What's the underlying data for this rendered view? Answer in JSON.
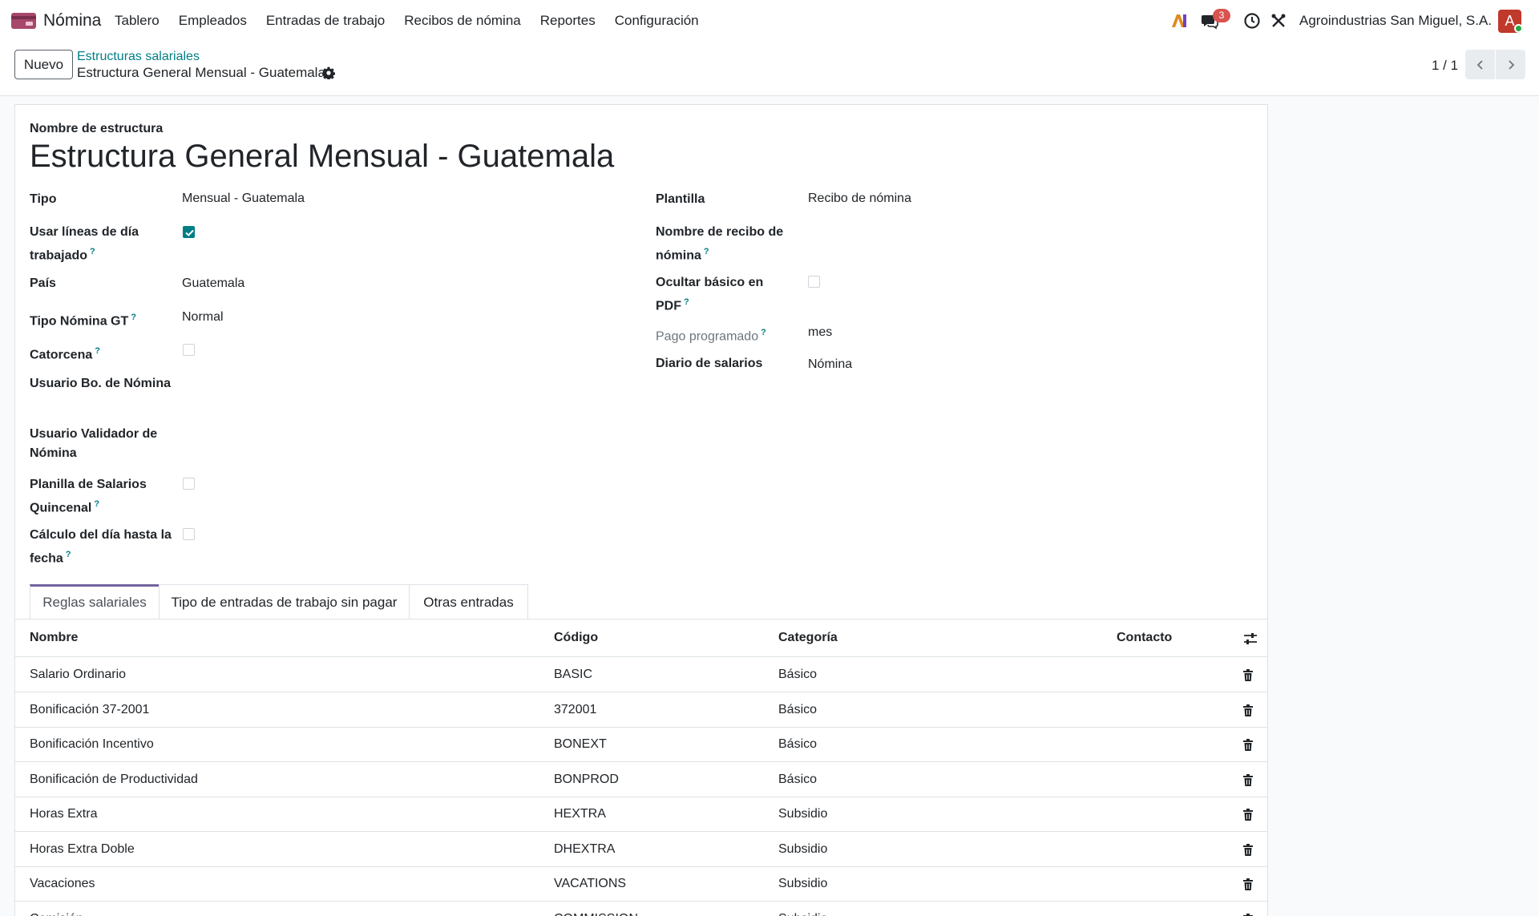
{
  "navbar": {
    "app_name": "Nómina",
    "menu": [
      "Tablero",
      "Empleados",
      "Entradas de trabajo",
      "Recibos de nómina",
      "Reportes",
      "Configuración"
    ],
    "chat_count": "3",
    "company": "Agroindustrias San Miguel, S.A.",
    "avatar_letter": "A"
  },
  "control": {
    "new_label": "Nuevo",
    "breadcrumb_parent": "Estructuras salariales",
    "breadcrumb_current": "Estructura General Mensual - Guatemala",
    "pager": "1 / 1"
  },
  "form": {
    "struct_label": "Nombre de estructura",
    "struct_name": "Estructura General Mensual - Guatemala",
    "left": {
      "tipo_label": "Tipo",
      "tipo_value": "Mensual - Guatemala",
      "usar_lineas_label": "Usar líneas de día trabajado",
      "pais_label": "País",
      "pais_value": "Guatemala",
      "tipo_nomina_label": "Tipo Nómina GT",
      "tipo_nomina_value": "Normal",
      "catorcena_label": "Catorcena",
      "usuario_bo_label": "Usuario Bo. de Nómina",
      "usuario_val_label": "Usuario Validador de Nómina",
      "planilla_label": "Planilla de Salarios Quincenal",
      "calculo_label": "Cálculo del día hasta la fecha"
    },
    "right": {
      "plantilla_label": "Plantilla",
      "plantilla_value": "Recibo de nómina",
      "nombre_recibo_label": "Nombre de recibo de nómina",
      "ocultar_label": "Ocultar básico en PDF",
      "pago_label": "Pago programado",
      "pago_value": "mes",
      "diario_label": "Diario de salarios",
      "diario_value": "Nómina"
    },
    "help_mark": "?"
  },
  "tabs": [
    "Reglas salariales",
    "Tipo de entradas de trabajo sin pagar",
    "Otras entradas"
  ],
  "table": {
    "headers": [
      "Nombre",
      "Código",
      "Categoría",
      "Contacto"
    ],
    "rows": [
      {
        "nombre": "Salario Ordinario",
        "codigo": "BASIC",
        "categoria": "Básico"
      },
      {
        "nombre": "Bonificación 37-2001",
        "codigo": "372001",
        "categoria": "Básico"
      },
      {
        "nombre": "Bonificación Incentivo",
        "codigo": "BONEXT",
        "categoria": "Básico"
      },
      {
        "nombre": "Bonificación de Productividad",
        "codigo": "BONPROD",
        "categoria": "Básico"
      },
      {
        "nombre": "Horas Extra",
        "codigo": "HEXTRA",
        "categoria": "Subsidio"
      },
      {
        "nombre": "Horas Extra Doble",
        "codigo": "DHEXTRA",
        "categoria": "Subsidio"
      },
      {
        "nombre": "Vacaciones",
        "codigo": "VACATIONS",
        "categoria": "Subsidio"
      },
      {
        "nombre": "Comisión",
        "codigo": "COMMISSION",
        "categoria": "Subsidio"
      }
    ]
  },
  "colors": {
    "accent": "#017e84",
    "tab_active": "#71639e",
    "danger": "#d9534f"
  }
}
